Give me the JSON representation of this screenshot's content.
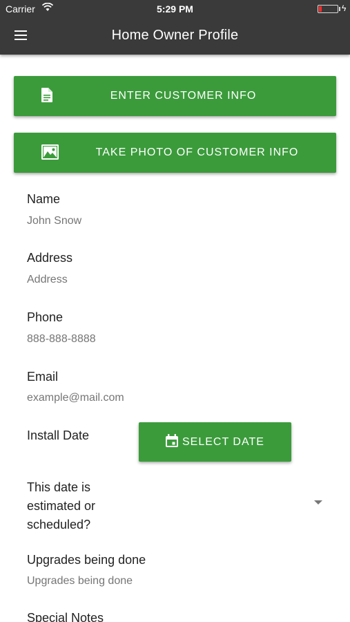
{
  "status_bar": {
    "carrier": "Carrier",
    "time": "5:29 PM"
  },
  "app_bar": {
    "title": "Home Owner Profile",
    "background": "#3a3a3a"
  },
  "actions": {
    "enter_info_label": "ENTER CUSTOMER INFO",
    "take_photo_label": "TAKE PHOTO OF CUSTOMER INFO",
    "accent": "#3b9b3b"
  },
  "form": {
    "name": {
      "label": "Name",
      "placeholder": "John Snow"
    },
    "address": {
      "label": "Address",
      "placeholder": "Address"
    },
    "phone": {
      "label": "Phone",
      "placeholder": "888-888-8888"
    },
    "email": {
      "label": "Email",
      "placeholder": "example@mail.com"
    },
    "install_date": {
      "label": "Install Date",
      "button_label": "SELECT DATE"
    },
    "date_type": {
      "label": "This date is estimated or scheduled?"
    },
    "upgrades": {
      "label": "Upgrades being done",
      "placeholder": "Upgrades being done"
    },
    "special_notes": {
      "label": "Special Notes"
    }
  }
}
